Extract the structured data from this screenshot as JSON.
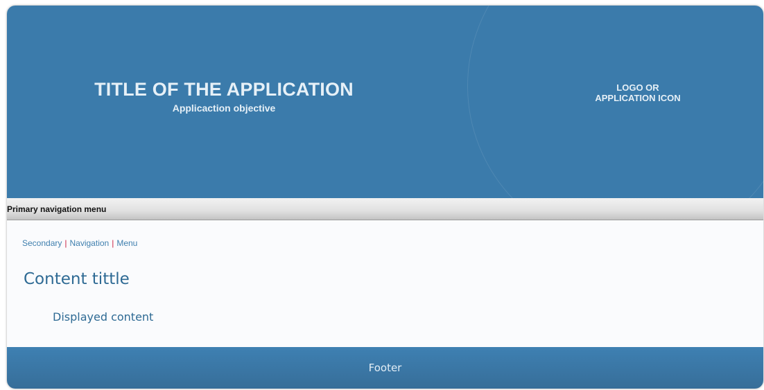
{
  "header": {
    "title": "TITLE OF THE APPLICATION",
    "subtitle": "Applicaction objective",
    "logo_line1": "LOGO OR",
    "logo_line2": "APPLICATION ICON"
  },
  "primary_nav": {
    "label": "Primary navigation menu"
  },
  "secondary_nav": {
    "items": [
      "Secondary",
      "Navigation",
      "Menu"
    ],
    "separator": "|"
  },
  "content": {
    "title": "Content tittle",
    "body": "Displayed content"
  },
  "footer": {
    "label": "Footer"
  },
  "colors": {
    "header_bg": "#3b7bab",
    "separator": "#cc2244",
    "link": "#3f7fae",
    "content_text": "#2e6a94"
  }
}
